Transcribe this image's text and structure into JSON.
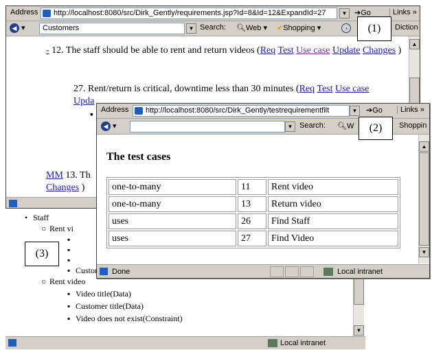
{
  "window1": {
    "address_label": "Address",
    "address_url": "http://localhost:8080/src/Dirk_Gently/requirements.jsp?Id=8&Id=12&ExpandId=27",
    "go_label": "Go",
    "links_label": "Links »",
    "search_box_value": "Customers",
    "search_label": "Search:",
    "web_label": "Web",
    "shopping_label": "Shopping",
    "dictionary_label": "Diction",
    "req12": {
      "toggle": "-",
      "text": " 12. The staff should be able to rent and return videos (",
      "links": [
        "Req",
        "Test",
        "Use case",
        "Update",
        "Changes"
      ],
      "close": " )"
    },
    "req27": {
      "text": "27. Rent/return is critical, downtime less than 30 minutes (",
      "links": [
        "Req",
        "Test",
        "Use case"
      ],
      "cont_link": "Upda"
    },
    "req13": {
      "toggle": "MM",
      "text": " 13. Th",
      "cont_link": "Changes",
      "close": " )"
    }
  },
  "window2": {
    "address_label": "Address",
    "address_url": "http://localhost:8080/src/Dirk_Gently/testrequirementfilt",
    "go_label": "Go",
    "links_label": "Links »",
    "search_label": "Search:",
    "web_label": "W",
    "shopping_label": "Shoppin",
    "heading": "The test cases",
    "rows": [
      [
        "one-to-many",
        "11",
        "Rent video"
      ],
      [
        "one-to-many",
        "13",
        "Return video"
      ],
      [
        "uses",
        "26",
        "Find Staff"
      ],
      [
        "uses",
        "27",
        "Find Video"
      ]
    ],
    "status_text": "Done",
    "zone_text": "Local intranet"
  },
  "window3": {
    "top_item": "Staff",
    "group1_label": "Rent vi",
    "group1_last": "Customer exists(Constraint)",
    "group2_label": "Rent video",
    "group2_items": [
      "Video title(Data)",
      "Customer title(Data)",
      "Video does not exist(Constraint)"
    ],
    "zone_text": "Local intranet"
  },
  "callouts": [
    "(1)",
    "(2)",
    "(3)"
  ],
  "colors": {
    "chrome": "#d4d0c8",
    "link": "#1a1aa6",
    "visited_link": "#7b2d92"
  }
}
